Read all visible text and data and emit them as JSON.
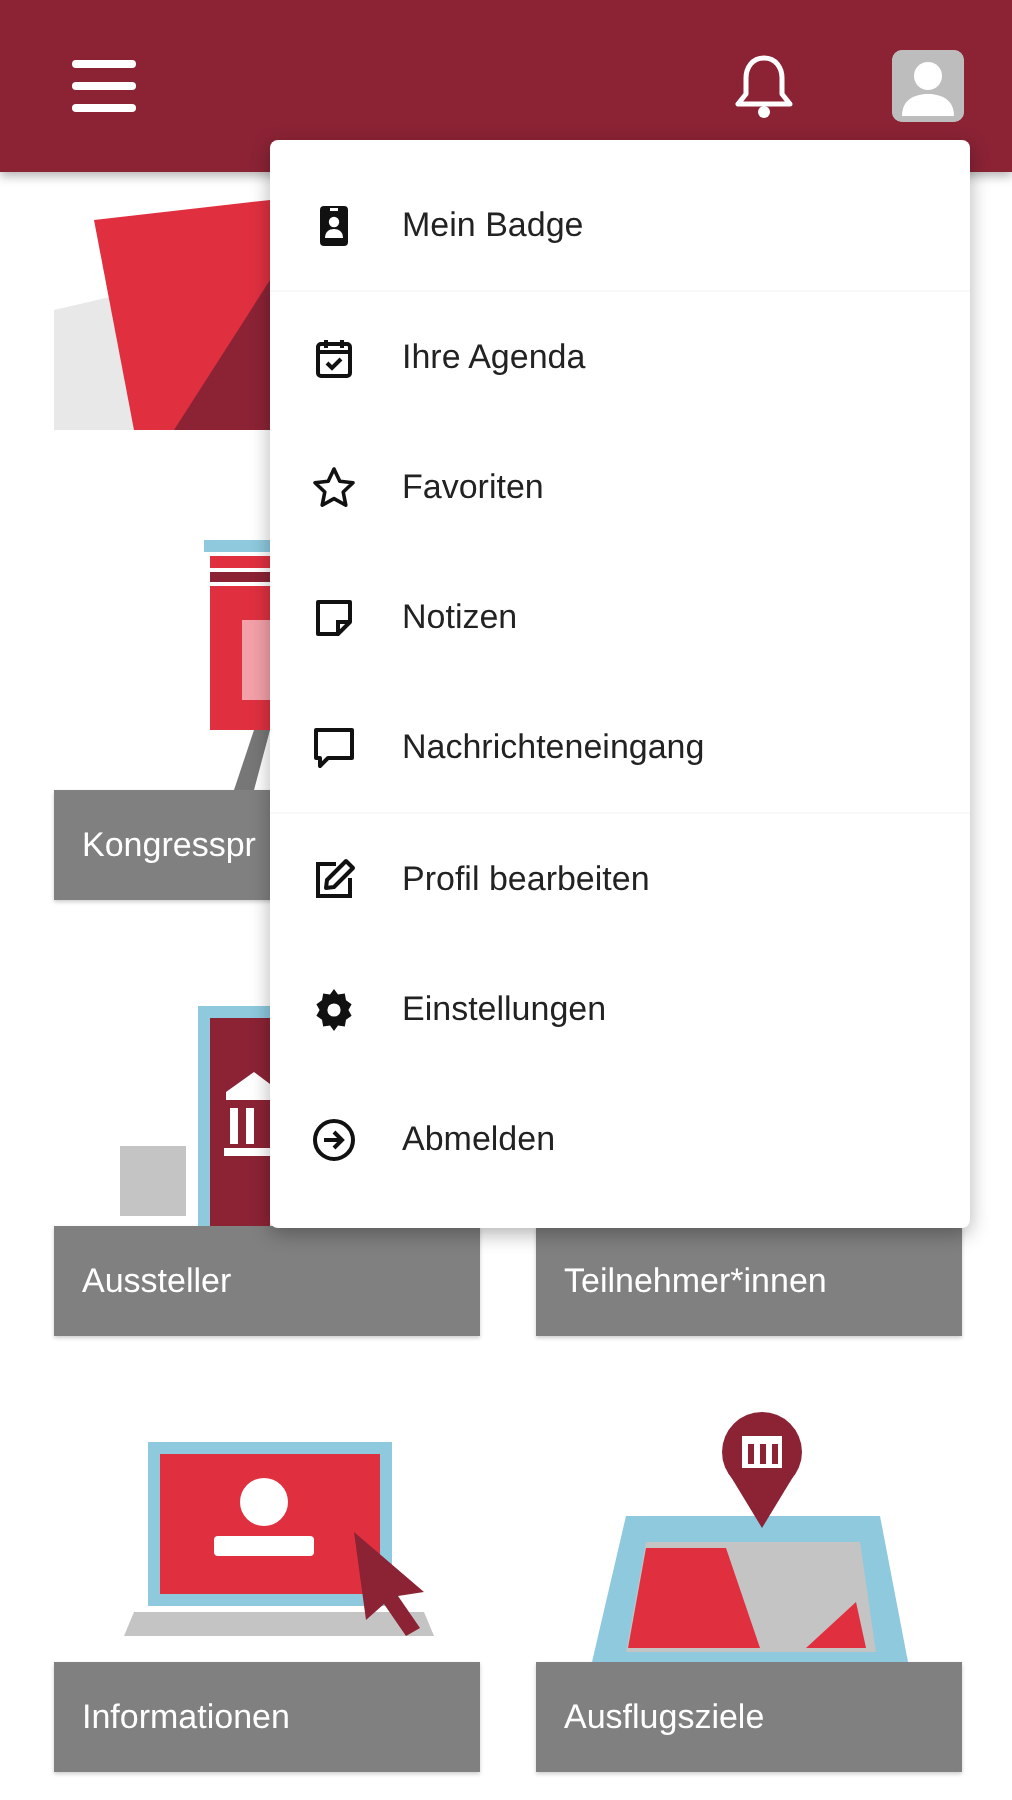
{
  "menu": {
    "sections": [
      [
        {
          "label": "Mein Badge",
          "kind": "badge"
        }
      ],
      [
        {
          "label": "Ihre Agenda",
          "kind": "agenda"
        },
        {
          "label": "Favoriten",
          "kind": "star"
        },
        {
          "label": "Notizen",
          "kind": "note"
        },
        {
          "label": "Nachrichteneingang",
          "kind": "chat"
        }
      ],
      [
        {
          "label": "Profil bearbeiten",
          "kind": "edit"
        },
        {
          "label": "Einstellungen",
          "kind": "settings"
        },
        {
          "label": "Abmelden",
          "kind": "logout"
        }
      ]
    ]
  },
  "tile_rows": [
    [
      {
        "label": "Kongresspr",
        "kind": "program"
      }
    ],
    [
      {
        "label": "Aussteller",
        "kind": "exhibitor"
      },
      {
        "label": "Teilnehmer*innen",
        "kind": "hidden"
      }
    ],
    [
      {
        "label": "Informationen",
        "kind": "news"
      },
      {
        "label": "Ausflugsziele",
        "kind": "map"
      }
    ]
  ]
}
